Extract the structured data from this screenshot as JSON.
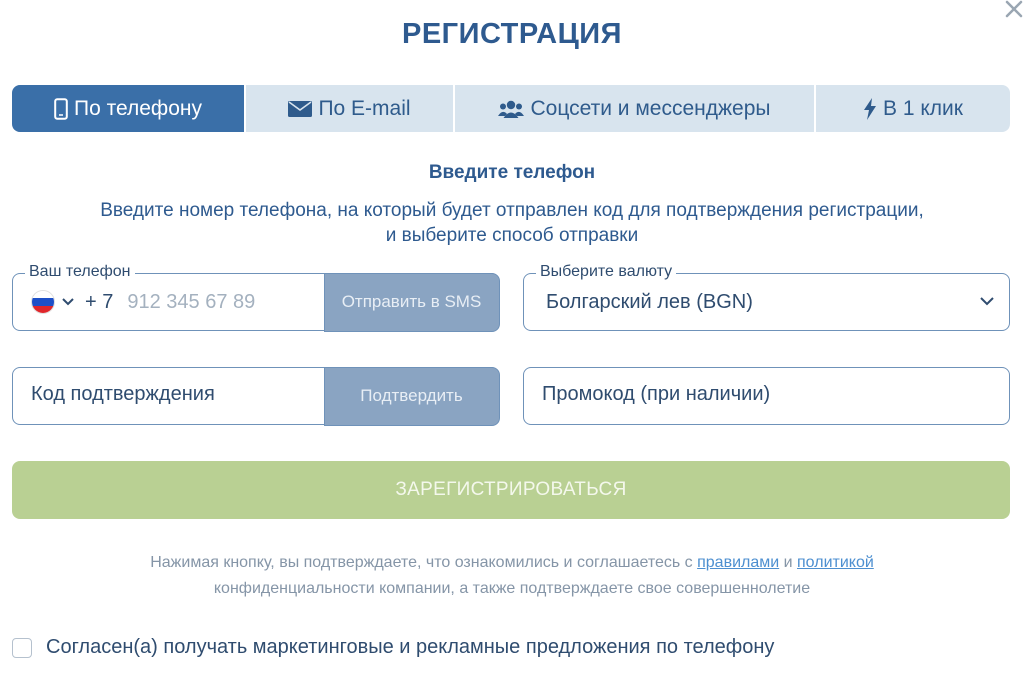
{
  "header": {
    "title": "РЕГИСТРАЦИЯ"
  },
  "tabs": [
    {
      "label": "По телефону",
      "icon": "phone-icon",
      "active": true
    },
    {
      "label": "По E-mail",
      "icon": "envelope-icon",
      "active": false
    },
    {
      "label": "Соцсети и мессенджеры",
      "icon": "users-icon",
      "active": false
    },
    {
      "label": "В 1 клик",
      "icon": "lightning-icon",
      "active": false
    }
  ],
  "form": {
    "subtitle": "Введите телефон",
    "description_line1": "Введите номер телефона, на который будет отправлен код для подтверждения регистрации,",
    "description_line2": "и выберите способ отправки",
    "phone": {
      "legend": "Ваш телефон",
      "prefix": "+ 7",
      "placeholder": "912 345 67 89",
      "send_button": "Отправить в SMS"
    },
    "currency": {
      "legend": "Выберите валюту",
      "value": "Болгарский лев (BGN)"
    },
    "code": {
      "placeholder": "Код подтверждения",
      "confirm_button": "Подтвердить"
    },
    "promo": {
      "placeholder": "Промокод (при наличии)"
    },
    "register_button": "ЗАРЕГИСТРИРОВАТЬСЯ",
    "terms": {
      "text_before": "Нажимая кнопку, вы подтверждаете, что ознакомились и соглашаетесь с ",
      "rules_link": "правилами",
      "and": " и ",
      "policy_link": "политикой",
      "line2": "конфиденциальности компании, а также подтверждаете свое совершеннолетие"
    },
    "consent_label": "Согласен(а) получать маркетинговые и рекламные предложения по телефону"
  },
  "colors": {
    "primary": "#2e5a8f",
    "active_tab": "#3a6fa8",
    "inactive_tab": "#d8e4ee",
    "register": "#b9d093",
    "side_button": "#8aa4c2",
    "link": "#4d8fd0"
  }
}
